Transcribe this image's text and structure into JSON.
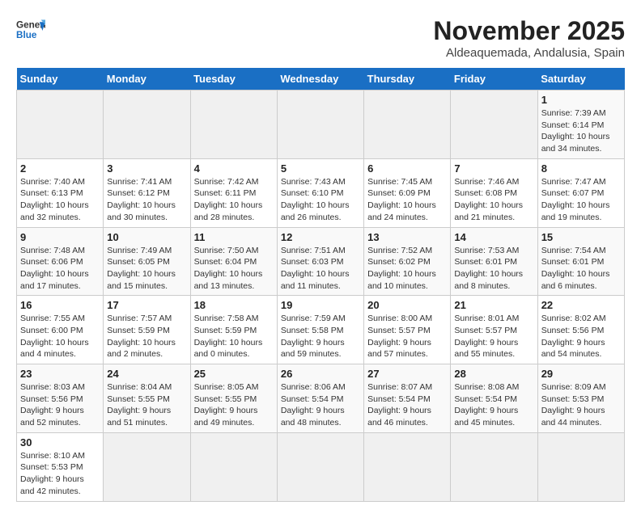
{
  "header": {
    "logo_general": "General",
    "logo_blue": "Blue",
    "month": "November 2025",
    "location": "Aldeaquemada, Andalusia, Spain"
  },
  "weekdays": [
    "Sunday",
    "Monday",
    "Tuesday",
    "Wednesday",
    "Thursday",
    "Friday",
    "Saturday"
  ],
  "weeks": [
    [
      {
        "day": "",
        "info": ""
      },
      {
        "day": "",
        "info": ""
      },
      {
        "day": "",
        "info": ""
      },
      {
        "day": "",
        "info": ""
      },
      {
        "day": "",
        "info": ""
      },
      {
        "day": "",
        "info": ""
      },
      {
        "day": "1",
        "info": "Sunrise: 7:39 AM\nSunset: 6:14 PM\nDaylight: 10 hours and 34 minutes."
      }
    ],
    [
      {
        "day": "2",
        "info": "Sunrise: 7:40 AM\nSunset: 6:13 PM\nDaylight: 10 hours and 32 minutes."
      },
      {
        "day": "3",
        "info": "Sunrise: 7:41 AM\nSunset: 6:12 PM\nDaylight: 10 hours and 30 minutes."
      },
      {
        "day": "4",
        "info": "Sunrise: 7:42 AM\nSunset: 6:11 PM\nDaylight: 10 hours and 28 minutes."
      },
      {
        "day": "5",
        "info": "Sunrise: 7:43 AM\nSunset: 6:10 PM\nDaylight: 10 hours and 26 minutes."
      },
      {
        "day": "6",
        "info": "Sunrise: 7:45 AM\nSunset: 6:09 PM\nDaylight: 10 hours and 24 minutes."
      },
      {
        "day": "7",
        "info": "Sunrise: 7:46 AM\nSunset: 6:08 PM\nDaylight: 10 hours and 21 minutes."
      },
      {
        "day": "8",
        "info": "Sunrise: 7:47 AM\nSunset: 6:07 PM\nDaylight: 10 hours and 19 minutes."
      }
    ],
    [
      {
        "day": "9",
        "info": "Sunrise: 7:48 AM\nSunset: 6:06 PM\nDaylight: 10 hours and 17 minutes."
      },
      {
        "day": "10",
        "info": "Sunrise: 7:49 AM\nSunset: 6:05 PM\nDaylight: 10 hours and 15 minutes."
      },
      {
        "day": "11",
        "info": "Sunrise: 7:50 AM\nSunset: 6:04 PM\nDaylight: 10 hours and 13 minutes."
      },
      {
        "day": "12",
        "info": "Sunrise: 7:51 AM\nSunset: 6:03 PM\nDaylight: 10 hours and 11 minutes."
      },
      {
        "day": "13",
        "info": "Sunrise: 7:52 AM\nSunset: 6:02 PM\nDaylight: 10 hours and 10 minutes."
      },
      {
        "day": "14",
        "info": "Sunrise: 7:53 AM\nSunset: 6:01 PM\nDaylight: 10 hours and 8 minutes."
      },
      {
        "day": "15",
        "info": "Sunrise: 7:54 AM\nSunset: 6:01 PM\nDaylight: 10 hours and 6 minutes."
      }
    ],
    [
      {
        "day": "16",
        "info": "Sunrise: 7:55 AM\nSunset: 6:00 PM\nDaylight: 10 hours and 4 minutes."
      },
      {
        "day": "17",
        "info": "Sunrise: 7:57 AM\nSunset: 5:59 PM\nDaylight: 10 hours and 2 minutes."
      },
      {
        "day": "18",
        "info": "Sunrise: 7:58 AM\nSunset: 5:59 PM\nDaylight: 10 hours and 0 minutes."
      },
      {
        "day": "19",
        "info": "Sunrise: 7:59 AM\nSunset: 5:58 PM\nDaylight: 9 hours and 59 minutes."
      },
      {
        "day": "20",
        "info": "Sunrise: 8:00 AM\nSunset: 5:57 PM\nDaylight: 9 hours and 57 minutes."
      },
      {
        "day": "21",
        "info": "Sunrise: 8:01 AM\nSunset: 5:57 PM\nDaylight: 9 hours and 55 minutes."
      },
      {
        "day": "22",
        "info": "Sunrise: 8:02 AM\nSunset: 5:56 PM\nDaylight: 9 hours and 54 minutes."
      }
    ],
    [
      {
        "day": "23",
        "info": "Sunrise: 8:03 AM\nSunset: 5:56 PM\nDaylight: 9 hours and 52 minutes."
      },
      {
        "day": "24",
        "info": "Sunrise: 8:04 AM\nSunset: 5:55 PM\nDaylight: 9 hours and 51 minutes."
      },
      {
        "day": "25",
        "info": "Sunrise: 8:05 AM\nSunset: 5:55 PM\nDaylight: 9 hours and 49 minutes."
      },
      {
        "day": "26",
        "info": "Sunrise: 8:06 AM\nSunset: 5:54 PM\nDaylight: 9 hours and 48 minutes."
      },
      {
        "day": "27",
        "info": "Sunrise: 8:07 AM\nSunset: 5:54 PM\nDaylight: 9 hours and 46 minutes."
      },
      {
        "day": "28",
        "info": "Sunrise: 8:08 AM\nSunset: 5:54 PM\nDaylight: 9 hours and 45 minutes."
      },
      {
        "day": "29",
        "info": "Sunrise: 8:09 AM\nSunset: 5:53 PM\nDaylight: 9 hours and 44 minutes."
      }
    ],
    [
      {
        "day": "30",
        "info": "Sunrise: 8:10 AM\nSunset: 5:53 PM\nDaylight: 9 hours and 42 minutes."
      },
      {
        "day": "",
        "info": ""
      },
      {
        "day": "",
        "info": ""
      },
      {
        "day": "",
        "info": ""
      },
      {
        "day": "",
        "info": ""
      },
      {
        "day": "",
        "info": ""
      },
      {
        "day": "",
        "info": ""
      }
    ]
  ]
}
